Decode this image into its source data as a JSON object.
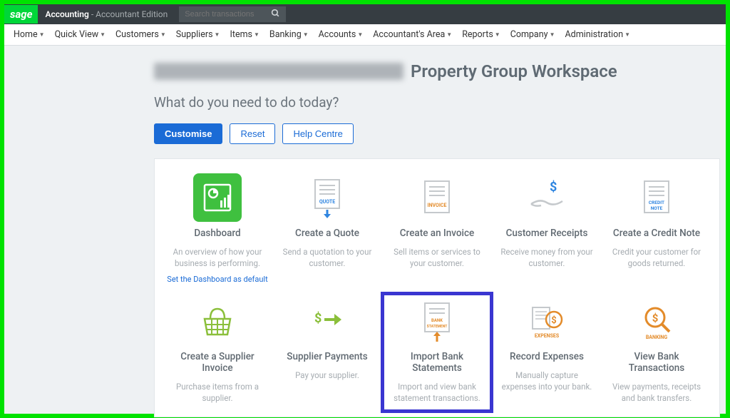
{
  "topbar": {
    "logo": "sage",
    "brand_main": "Accounting",
    "brand_sub": " - Accountant Edition",
    "search_placeholder": "Search transactions"
  },
  "menu": [
    "Home",
    "Quick View",
    "Customers",
    "Suppliers",
    "Items",
    "Banking",
    "Accounts",
    "Accountant's Area",
    "Reports",
    "Company",
    "Administration"
  ],
  "hero": {
    "title": "Property Group Workspace",
    "subtitle": "What do you need to do today?"
  },
  "buttons": {
    "customise": "Customise",
    "reset": "Reset",
    "help": "Help Centre"
  },
  "cards": [
    {
      "title": "Dashboard",
      "desc": "An overview of how your business is performing.",
      "link": "Set the Dashboard as default",
      "icon": "dashboard"
    },
    {
      "title": "Create a Quote",
      "desc": "Send a quotation to your customer.",
      "icon": "quote"
    },
    {
      "title": "Create an Invoice",
      "desc": "Sell items or services to your customer.",
      "icon": "invoice"
    },
    {
      "title": "Customer Receipts",
      "desc": "Receive money from your customer.",
      "icon": "receipts"
    },
    {
      "title": "Create a Credit Note",
      "desc": "Credit your customer for goods returned.",
      "icon": "creditnote"
    },
    {
      "title": "Create a Supplier Invoice",
      "desc": "Purchase items from a supplier.",
      "icon": "basket"
    },
    {
      "title": "Supplier Payments",
      "desc": "Pay your supplier.",
      "icon": "payments"
    },
    {
      "title": "Import Bank Statements",
      "desc": "Import and view bank statement transactions.",
      "icon": "bankstatement",
      "highlight": true
    },
    {
      "title": "Record Expenses",
      "desc": "Manually capture expenses into your bank.",
      "icon": "expenses"
    },
    {
      "title": "View Bank Transactions",
      "desc": "View payments, receipts and bank transfers.",
      "icon": "banking"
    }
  ]
}
